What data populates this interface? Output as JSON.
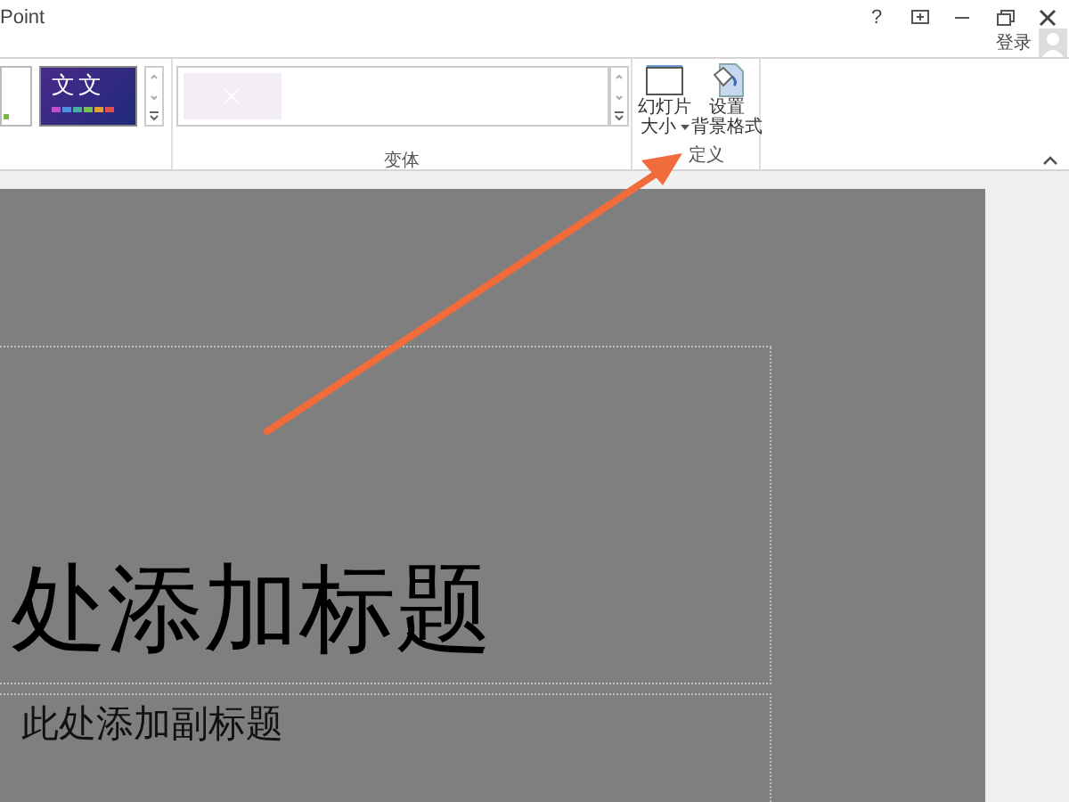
{
  "window": {
    "title": "Point",
    "controls": [
      "?"
    ]
  },
  "account": {
    "sign_in": "登录"
  },
  "ribbon": {
    "themes": [
      {
        "kind": "plain"
      },
      {
        "kind": "sample",
        "text": "文文"
      }
    ],
    "variants_group": {
      "label": "变体"
    },
    "customize_group": {
      "label": "定义",
      "buttons": [
        {
          "label": "幻灯片",
          "label2": "大小",
          "dropdown": true
        },
        {
          "label": "设置",
          "label2": "背景格式",
          "dropdown": false
        }
      ]
    }
  },
  "slide": {
    "title": "处添加标题",
    "subtitle": "此处添加副标题"
  }
}
